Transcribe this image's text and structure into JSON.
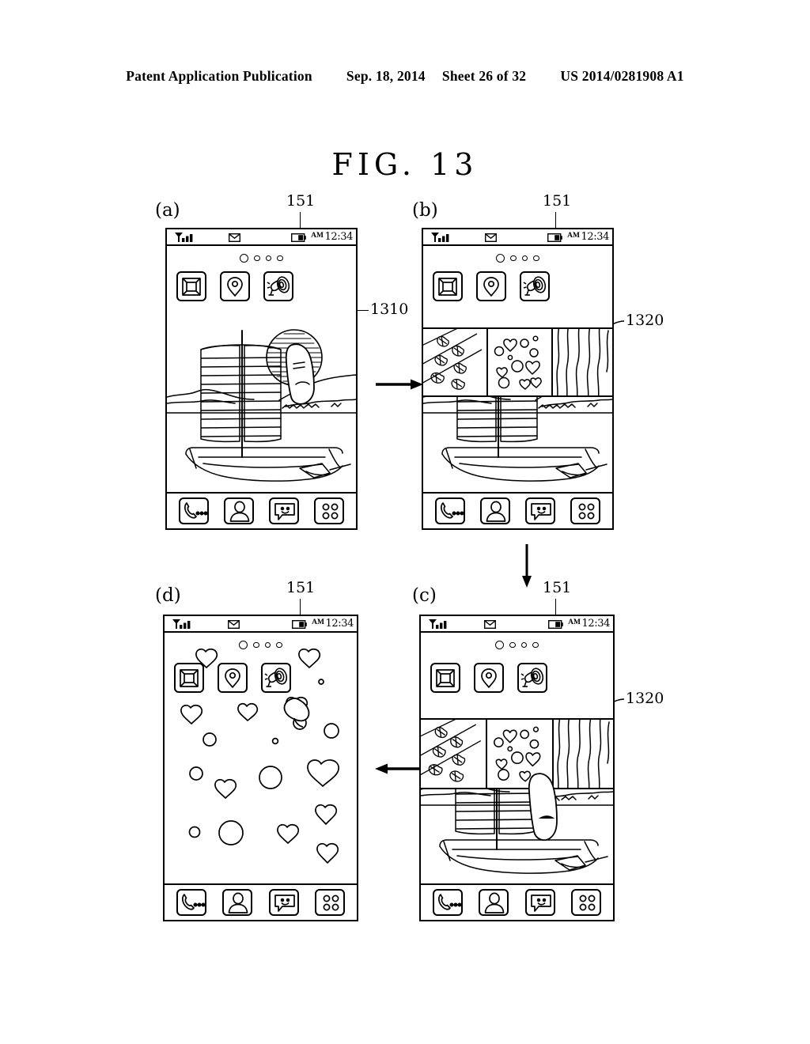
{
  "header": {
    "left": "Patent Application Publication",
    "date": "Sep. 18, 2014",
    "sheet": "Sheet 26 of 32",
    "patent_number": "US 2014/0281908 A1"
  },
  "figure": {
    "title": "FIG.  13"
  },
  "status_bar": {
    "am_label": "AM",
    "time": "12:34",
    "icons": [
      "signal-bars-icon",
      "envelope-icon",
      "battery-icon"
    ]
  },
  "page_indicator": {
    "total": 4,
    "active_index": 0
  },
  "app_icons": [
    {
      "name": "gallery-icon",
      "label": "Gallery"
    },
    {
      "name": "map-pin-icon",
      "label": "Maps"
    },
    {
      "name": "megaphone-icon",
      "label": "Sound"
    }
  ],
  "dock_icons": [
    {
      "name": "phone-dialer-icon",
      "label": "Phone"
    },
    {
      "name": "contacts-person-icon",
      "label": "Contacts"
    },
    {
      "name": "messages-smiley-icon",
      "label": "Messages"
    },
    {
      "name": "apps-grid-icon",
      "label": "Apps"
    }
  ],
  "panels": [
    {
      "letter": "(a)",
      "ref_top": "151",
      "ref_side": "1310",
      "wallpaper": "sailboat-scene",
      "overlay": "none",
      "touch": "touch-circle-on-wallpaper"
    },
    {
      "letter": "(b)",
      "ref_top": "151",
      "ref_side": "1320",
      "wallpaper": "sailboat-scene",
      "overlay": "effect-thumbnail-strip",
      "touch": "none"
    },
    {
      "letter": "(c)",
      "ref_top": "151",
      "ref_side": "1320",
      "wallpaper": "sailboat-scene",
      "overlay": "effect-thumbnail-strip",
      "touch": "finger-selecting-bubbles-thumbnail"
    },
    {
      "letter": "(d)",
      "ref_top": "151",
      "ref_side": "",
      "wallpaper": "hearts-and-bubbles",
      "overlay": "none",
      "touch": "finger-near-megaphone-icon"
    }
  ],
  "effect_thumbnails": [
    {
      "name": "falling-leaves-effect",
      "label": "Leaves"
    },
    {
      "name": "hearts-bubbles-effect",
      "label": "Hearts"
    },
    {
      "name": "rain-streaks-effect",
      "label": "Rain"
    }
  ],
  "flow_arrows": [
    {
      "name": "arrow-a-to-b",
      "direction": "right"
    },
    {
      "name": "arrow-b-to-c",
      "direction": "down"
    },
    {
      "name": "arrow-c-to-d",
      "direction": "left"
    }
  ]
}
